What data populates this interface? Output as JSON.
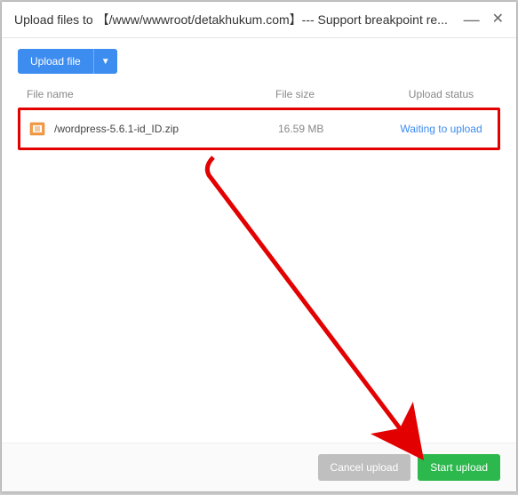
{
  "titlebar": {
    "title": "Upload files to 【/www/wwwroot/detakhukum.com】--- Support breakpoint re..."
  },
  "toolbar": {
    "upload_label": "Upload file"
  },
  "table": {
    "headers": {
      "name": "File name",
      "size": "File size",
      "status": "Upload status"
    },
    "rows": [
      {
        "name": "/wordpress-5.6.1-id_ID.zip",
        "size": "16.59 MB",
        "status": "Waiting to upload"
      }
    ]
  },
  "footer": {
    "cancel_label": "Cancel upload",
    "start_label": "Start upload"
  }
}
